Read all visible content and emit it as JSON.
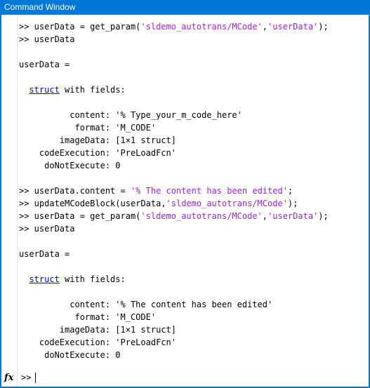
{
  "window": {
    "title": "Command Window"
  },
  "lines": [
    [
      {
        "t": "n",
        "v": ">> userData = get_param("
      },
      {
        "t": "s",
        "v": "'sldemo_autotrans/MCode'"
      },
      {
        "t": "n",
        "v": ","
      },
      {
        "t": "s",
        "v": "'userData'"
      },
      {
        "t": "n",
        "v": ");"
      }
    ],
    [
      {
        "t": "n",
        "v": ">> userData"
      }
    ],
    [
      {
        "t": "n",
        "v": ""
      }
    ],
    [
      {
        "t": "n",
        "v": "userData ="
      }
    ],
    [
      {
        "t": "n",
        "v": ""
      }
    ],
    [
      {
        "t": "n",
        "v": "  "
      },
      {
        "t": "k",
        "v": "struct"
      },
      {
        "t": "n",
        "v": " with fields:"
      }
    ],
    [
      {
        "t": "n",
        "v": ""
      }
    ],
    [
      {
        "t": "n",
        "v": "          content: '% Type_your_m_code_here'"
      }
    ],
    [
      {
        "t": "n",
        "v": "           format: 'M_CODE'"
      }
    ],
    [
      {
        "t": "n",
        "v": "        imageData: [1×1 struct]"
      }
    ],
    [
      {
        "t": "n",
        "v": "    codeExecution: 'PreLoadFcn'"
      }
    ],
    [
      {
        "t": "n",
        "v": "     doNotExecute: 0"
      }
    ],
    [
      {
        "t": "n",
        "v": ""
      }
    ],
    [
      {
        "t": "n",
        "v": ">> userData.content = "
      },
      {
        "t": "s",
        "v": "'% The content has been edited'"
      },
      {
        "t": "n",
        "v": ";"
      }
    ],
    [
      {
        "t": "n",
        "v": ">> updateMCodeBlock(userData,"
      },
      {
        "t": "s",
        "v": "'sldemo_autotrans/MCode'"
      },
      {
        "t": "n",
        "v": ");"
      }
    ],
    [
      {
        "t": "n",
        "v": ">> userData = get_param("
      },
      {
        "t": "s",
        "v": "'sldemo_autotrans/MCode'"
      },
      {
        "t": "n",
        "v": ","
      },
      {
        "t": "s",
        "v": "'userData'"
      },
      {
        "t": "n",
        "v": ");"
      }
    ],
    [
      {
        "t": "n",
        "v": ">> userData"
      }
    ],
    [
      {
        "t": "n",
        "v": ""
      }
    ],
    [
      {
        "t": "n",
        "v": "userData ="
      }
    ],
    [
      {
        "t": "n",
        "v": ""
      }
    ],
    [
      {
        "t": "n",
        "v": "  "
      },
      {
        "t": "k",
        "v": "struct"
      },
      {
        "t": "n",
        "v": " with fields:"
      }
    ],
    [
      {
        "t": "n",
        "v": ""
      }
    ],
    [
      {
        "t": "n",
        "v": "          content: '% The content has been edited'"
      }
    ],
    [
      {
        "t": "n",
        "v": "           format: 'M_CODE'"
      }
    ],
    [
      {
        "t": "n",
        "v": "        imageData: [1×1 struct]"
      }
    ],
    [
      {
        "t": "n",
        "v": "    codeExecution: 'PreLoadFcn'"
      }
    ],
    [
      {
        "t": "n",
        "v": "     doNotExecute: 0"
      }
    ]
  ],
  "prompt": {
    "fx_label": "fx",
    "prompt_text": ">>",
    "input_value": ""
  },
  "colors": {
    "titlebar": "#0078d7",
    "string": "#a020f0",
    "keyword_link": "#0000ff"
  }
}
